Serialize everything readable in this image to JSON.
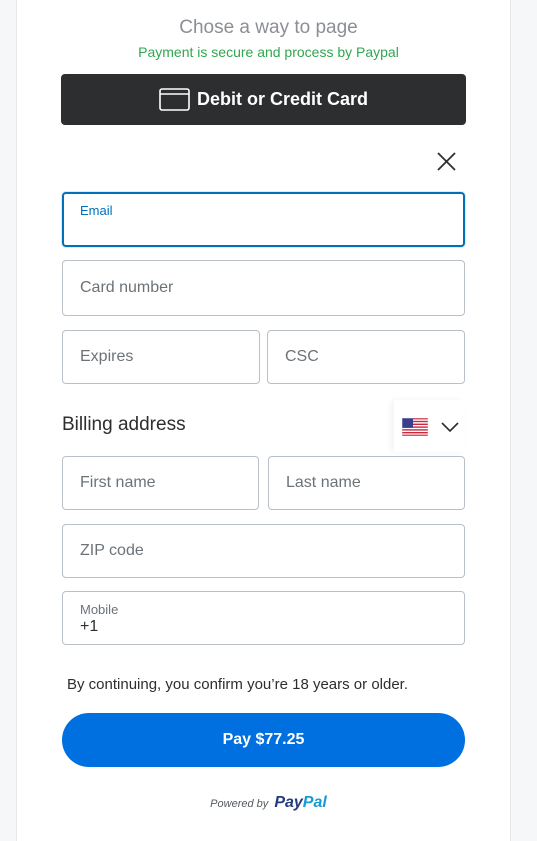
{
  "header": {
    "title": "Chose a way to page",
    "subtitle": "Payment is secure and process by Paypal"
  },
  "card_button": {
    "label": "Debit or Credit Card",
    "icon": "credit-card-icon"
  },
  "form": {
    "email": {
      "label": "Email",
      "value": ""
    },
    "card_number": {
      "placeholder": "Card number"
    },
    "expires": {
      "placeholder": "Expires"
    },
    "csc": {
      "placeholder": "CSC"
    },
    "billing_title": "Billing address",
    "country": {
      "icon": "us-flag-icon",
      "chevron": "chevron-down-icon"
    },
    "first_name": {
      "placeholder": "First name"
    },
    "last_name": {
      "placeholder": "Last name"
    },
    "zip": {
      "placeholder": "ZIP code"
    },
    "mobile": {
      "label": "Mobile",
      "value": "+1"
    }
  },
  "confirm_text": "By continuing, you confirm you’re 18 years or older.",
  "pay_button": {
    "label": "Pay $77.25"
  },
  "footer": {
    "powered_by": "Powered by",
    "brand_part1": "Pay",
    "brand_part2": "Pal"
  },
  "colors": {
    "accent": "#0070e0",
    "focus": "#0070ba",
    "secure_text": "#2fa84f",
    "card_button_bg": "#2c2e2f"
  }
}
